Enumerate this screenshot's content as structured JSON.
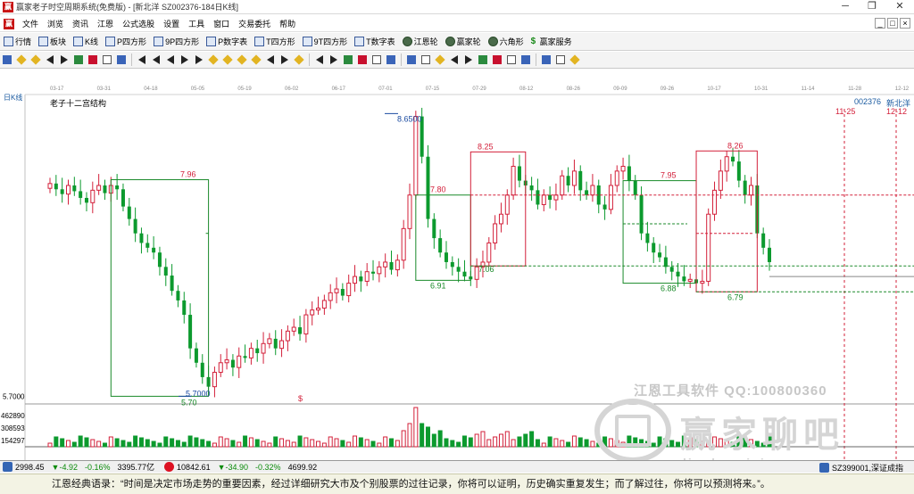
{
  "window": {
    "title": "赢家老子时空周期系统(免费版) - [新北洋  SZ002376-184日K线]",
    "minimize": "─",
    "maximize": "❐",
    "close": "✕"
  },
  "menu": {
    "items": [
      "文件",
      "浏览",
      "资讯",
      "江恩",
      "公式选股",
      "设置",
      "工具",
      "窗口",
      "交易委托",
      "帮助"
    ],
    "mdi_buttons": [
      "_",
      "□",
      "×"
    ]
  },
  "toolbar1": {
    "items": [
      {
        "label": "行情",
        "icon": "grid-icon",
        "style": ""
      },
      {
        "label": "板块",
        "icon": "block-icon",
        "style": ""
      },
      {
        "label": "K线",
        "icon": "kline-icon",
        "style": ""
      },
      {
        "label": "P四方形",
        "icon": "p-square-icon",
        "style": ""
      },
      {
        "label": "9P四方形",
        "icon": "9p-square-icon",
        "style": ""
      },
      {
        "label": "P数字表",
        "icon": "p-table-icon",
        "style": ""
      },
      {
        "label": "T四方形",
        "icon": "t-square-icon",
        "style": ""
      },
      {
        "label": "9T四方形",
        "icon": "9t-square-icon",
        "style": ""
      },
      {
        "label": "T数字表",
        "icon": "t-table-icon",
        "style": ""
      },
      {
        "label": "江恩轮",
        "icon": "gann-wheel-icon",
        "style": "round"
      },
      {
        "label": "赢家轮",
        "icon": "winner-wheel-icon",
        "style": "round"
      },
      {
        "label": "六角形",
        "icon": "hexagon-icon",
        "style": "round"
      },
      {
        "label": "赢家服务",
        "icon": "dollar-icon",
        "style": "dollar"
      }
    ]
  },
  "toolbar2": {
    "icons": [
      "period-icon",
      "chevron-down-icon",
      "cycle-icon",
      "calendar-icon",
      "chart-icon",
      "bar-icon",
      "ratio-icon",
      "dollar-icon",
      "flag-icon",
      "sep",
      "first-icon",
      "prev-page-icon",
      "prev-icon",
      "next-icon",
      "next-page-icon",
      "zoom-in-icon",
      "zoom-out-icon",
      "up-icon",
      "down-icon",
      "left-icon",
      "right-icon",
      "expand-icon",
      "sep",
      "hand-icon",
      "crosshair-icon",
      "line-icon",
      "text-icon",
      "eraser-icon",
      "select-icon",
      "sep",
      "save-icon",
      "load-icon",
      "list-icon",
      "copy-icon",
      "paste-icon",
      "delete-icon",
      "undo-icon",
      "percent-icon",
      "grid-icon",
      "sep",
      "print-icon",
      "color-icon",
      "infinity-icon"
    ]
  },
  "chart_header": {
    "period_label": "日K线",
    "indicator_name": "老子十二宫结构",
    "stock_code": "002376",
    "stock_name": "新北洋",
    "date_11_25": "11-25",
    "date_12_12": "12-12",
    "left_axis_price": "5.7000"
  },
  "date_strip": [
    "03-17",
    "03-31",
    "04-18",
    "05-05",
    "05-19",
    "06-02",
    "06-17",
    "07-01",
    "07-15",
    "07-29",
    "08-12",
    "08-26",
    "09-09",
    "09-26",
    "10-17",
    "10-31",
    "11-14",
    "11-28",
    "12-12"
  ],
  "chart_data": {
    "type": "candlestick",
    "title": "老子十二宫结构",
    "price_labels": [
      {
        "label": "7.96",
        "value": 7.96
      },
      {
        "label": "5.70",
        "value": 5.7
      },
      {
        "label": "5.7000",
        "value": 5.7
      },
      {
        "label": "8.6500",
        "value": 8.65
      },
      {
        "label": "8.25",
        "value": 8.25
      },
      {
        "label": "7.80",
        "value": 7.8
      },
      {
        "label": "7.06",
        "value": 7.06
      },
      {
        "label": "6.91",
        "value": 6.91
      },
      {
        "label": "7.95",
        "value": 7.95
      },
      {
        "label": "6.88",
        "value": 6.88
      },
      {
        "label": "8.26",
        "value": 8.26
      },
      {
        "label": "6.79",
        "value": 6.79
      }
    ],
    "candles_close": [
      7.92,
      7.86,
      7.81,
      7.9,
      7.84,
      7.77,
      7.72,
      7.85,
      7.9,
      7.82,
      7.9,
      7.86,
      7.68,
      7.55,
      7.4,
      7.3,
      7.25,
      7.2,
      7.05,
      6.96,
      6.8,
      6.7,
      6.55,
      6.2,
      6.05,
      5.9,
      5.8,
      5.95,
      6.05,
      6.08,
      6.0,
      6.12,
      6.1,
      6.2,
      6.15,
      6.25,
      6.3,
      6.2,
      6.28,
      6.38,
      6.42,
      6.35,
      6.55,
      6.6,
      6.62,
      6.7,
      6.78,
      6.82,
      6.75,
      6.88,
      6.95,
      6.9,
      7.0,
      6.98,
      7.05,
      7.1,
      7.02,
      7.12,
      7.45,
      7.8,
      8.62,
      8.2,
      7.55,
      7.35,
      7.2,
      7.1,
      7.05,
      7.0,
      6.95,
      6.92,
      7.05,
      7.1,
      7.3,
      7.5,
      7.6,
      7.8,
      8.1,
      7.95,
      7.9,
      7.85,
      7.7,
      7.8,
      7.75,
      7.8,
      8.0,
      7.9,
      8.05,
      7.85,
      7.8,
      7.9,
      7.7,
      7.65,
      7.9,
      8.05,
      8.1,
      7.95,
      7.8,
      7.4,
      7.3,
      7.2,
      7.15,
      7.05,
      7.0,
      6.95,
      6.9,
      6.92,
      6.88,
      6.9,
      7.6,
      7.85,
      8.05,
      8.2,
      8.15,
      7.95,
      7.8,
      7.9,
      7.4,
      7.25,
      7.1
    ],
    "volume_axis_labels": [
      "462890",
      "308593",
      "154297"
    ],
    "volume_title": "$"
  },
  "watermark": {
    "line1": "江恩工具软件 QQ:100800360",
    "line2": "赢家聊吧",
    "line3": "liaoba.wjyj.com"
  },
  "status": {
    "index1_val": "2998.45",
    "index1_chg": "▼-4.92",
    "index1_pct": "-0.16%",
    "index1_amt": "3395.77亿",
    "index2_val": "10842.61",
    "index2_chg": "▼-34.90",
    "index2_pct": "-0.32%",
    "index2_amt": "4699.92",
    "right_code": "SZ399001,深证成指"
  },
  "tip": {
    "label": "江恩经典语录：",
    "text": "“时间是决定市场走势的重要因素，经过详细研究大市及个别股票的过往记录，你将可以证明，历史确实重复发生；而了解过往，你将可以预测将来。”。"
  },
  "colors": {
    "up": "#d3203a",
    "down": "#0c9a2e",
    "box_red": "#d3203a",
    "box_green": "#1a8a2a",
    "label_blue": "#1a4aa0"
  }
}
